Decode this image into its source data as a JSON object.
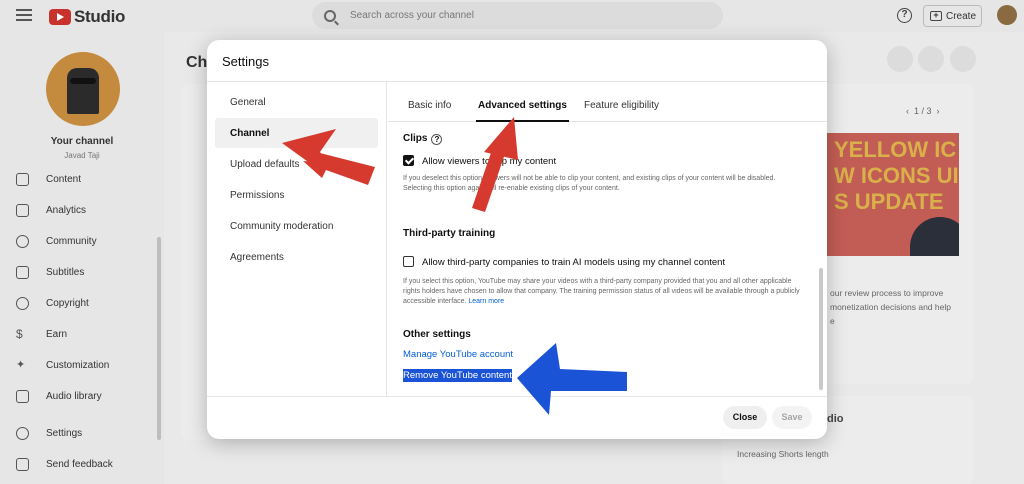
{
  "app": {
    "name": "Studio"
  },
  "header": {
    "search_placeholder": "Search across your channel",
    "create_label": "Create",
    "help_icon": "help-circle-icon"
  },
  "sidebar": {
    "channel_title": "Your channel",
    "channel_subtitle": "Javad Taji",
    "items": [
      {
        "label": "Content",
        "icon": "content-icon"
      },
      {
        "label": "Analytics",
        "icon": "analytics-icon"
      },
      {
        "label": "Community",
        "icon": "community-icon"
      },
      {
        "label": "Subtitles",
        "icon": "subtitles-icon"
      },
      {
        "label": "Copyright",
        "icon": "copyright-icon"
      },
      {
        "label": "Earn",
        "icon": "dollar-icon"
      },
      {
        "label": "Customization",
        "icon": "wand-icon"
      },
      {
        "label": "Audio library",
        "icon": "audio-library-icon"
      },
      {
        "label": "Settings",
        "icon": "gear-icon"
      },
      {
        "label": "Send feedback",
        "icon": "feedback-icon"
      }
    ]
  },
  "background": {
    "page_title": "Ch",
    "pager": "1 / 3",
    "promo_lines": [
      "YELLOW IC",
      "W ICONS UI",
      "S UPDATE"
    ],
    "review_text_1": "our review process to improve",
    "review_text_2": "monetization decisions and help",
    "review_text_3": "e",
    "card_heading": "dio",
    "card_text": "Increasing Shorts length"
  },
  "modal": {
    "title": "Settings",
    "side_items": [
      {
        "label": "General",
        "active": false
      },
      {
        "label": "Channel",
        "active": true
      },
      {
        "label": "Upload defaults",
        "active": false
      },
      {
        "label": "Permissions",
        "active": false
      },
      {
        "label": "Community moderation",
        "active": false
      },
      {
        "label": "Agreements",
        "active": false
      }
    ],
    "tabs": [
      {
        "label": "Basic info",
        "active": false
      },
      {
        "label": "Advanced settings",
        "active": true
      },
      {
        "label": "Feature eligibility",
        "active": false
      }
    ],
    "clips": {
      "title": "Clips",
      "checkbox_label": "Allow viewers to clip my content",
      "checked": true,
      "description": "If you deselect this option, viewers will not be able to clip your content, and existing clips of your content will be disabled. Selecting this option again will re-enable existing clips of your content."
    },
    "third_party": {
      "title": "Third-party training",
      "checkbox_label": "Allow third-party companies to train AI models using my channel content",
      "checked": false,
      "description": "If you select this option, YouTube may share your videos with a third-party company provided that you and all other applicable rights holders have chosen to allow that company. The training permission status of all videos will be available through a publicly accessible interface.",
      "learn_more": "Learn more"
    },
    "other": {
      "title": "Other settings",
      "manage_link": "Manage YouTube account",
      "remove_link": "Remove YouTube content"
    },
    "close_label": "Close",
    "save_label": "Save"
  },
  "colors": {
    "red_arrow": "#d63a2f",
    "blue_arrow": "#1a53d6",
    "link": "#065fd4",
    "brand_red": "#c8322d"
  }
}
